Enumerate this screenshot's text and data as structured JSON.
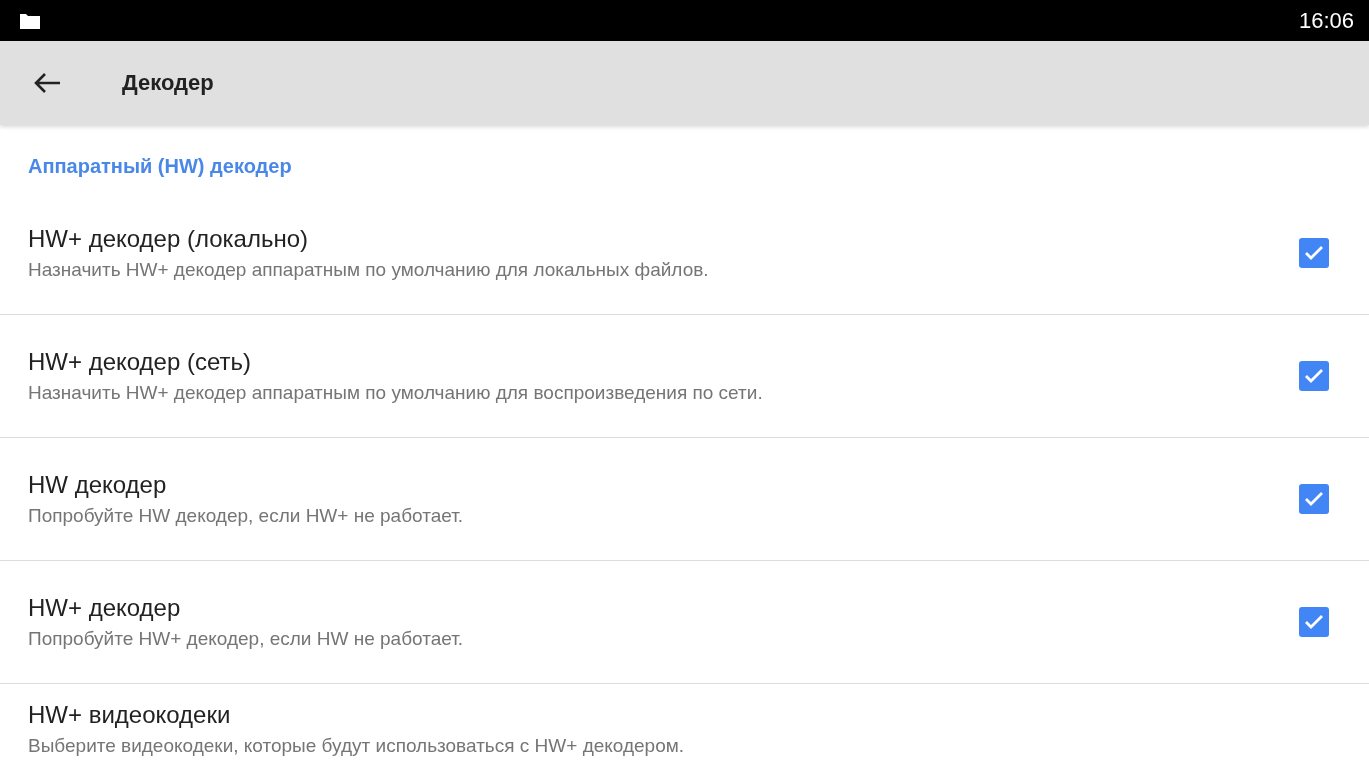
{
  "status_bar": {
    "time": "16:06"
  },
  "toolbar": {
    "title": "Декодер"
  },
  "section": {
    "title": "Аппаратный (HW) декодер"
  },
  "items": [
    {
      "kind": "checkbox",
      "title": "HW+ декодер (локально)",
      "summary": "Назначить HW+ декодер аппаратным по умолчанию для локальных файлов.",
      "checked": true
    },
    {
      "kind": "checkbox",
      "title": "HW+ декодер (сеть)",
      "summary": "Назначить HW+ декодер аппаратным по умолчанию для воспроизведения по сети.",
      "checked": true
    },
    {
      "kind": "checkbox",
      "title": "HW декодер",
      "summary": "Попробуйте HW декодер, если HW+ не работает.",
      "checked": true
    },
    {
      "kind": "checkbox",
      "title": "HW+ декодер",
      "summary": "Попробуйте HW+ декодер, если HW не работает.",
      "checked": true
    },
    {
      "kind": "text",
      "title": "HW+ видеокодеки",
      "summary": "Выберите видеокодеки, которые будут использоваться с HW+ декодером."
    }
  ]
}
